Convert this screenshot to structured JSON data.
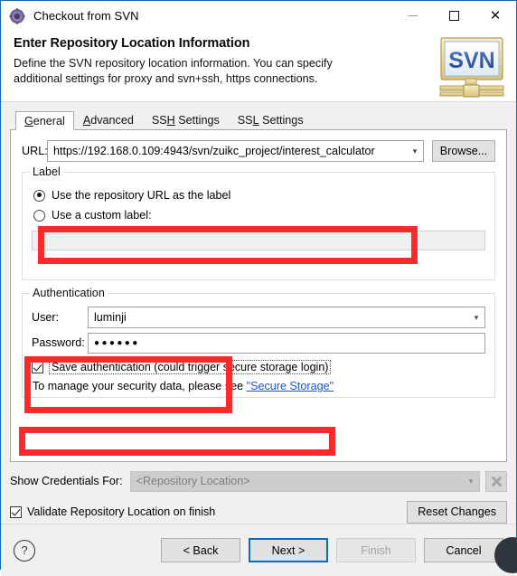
{
  "window": {
    "title": "Checkout from SVN",
    "icon": "svn-app-icon",
    "minimize_label": "—",
    "maximize_label": "□",
    "close_label": "✕"
  },
  "header": {
    "title": "Enter Repository Location Information",
    "description": "Define the SVN repository location information. You can specify additional settings for proxy and svn+ssh, https connections.",
    "logo_text": "SVN"
  },
  "tabs": [
    {
      "label": "General",
      "mnemonic": "G",
      "active": true
    },
    {
      "label": "Advanced",
      "mnemonic": "A",
      "active": false
    },
    {
      "label": "SSH Settings",
      "mnemonic": "H",
      "active": false
    },
    {
      "label": "SSL Settings",
      "mnemonic": "L",
      "active": false
    }
  ],
  "general": {
    "url_label": "URL:",
    "url_value": "https://192.168.0.109:4943/svn/zuikc_project/interest_calculator",
    "browse_label": "Browse...",
    "label_group": {
      "title": "Label",
      "option_repo_url": "Use the repository URL as the label",
      "option_repo_url_selected": true,
      "option_custom": "Use a custom label:",
      "option_custom_selected": false,
      "custom_value": "",
      "custom_enabled": false
    },
    "auth_group": {
      "title": "Authentication",
      "user_label": "User:",
      "user_value": "luminji",
      "password_label": "Password:",
      "password_value": "●●●●●●",
      "save_auth_label": "Save authentication (could trigger secure storage login)",
      "save_auth_checked": true,
      "secure_prefix": "To manage your security data, please see ",
      "secure_link": "\"Secure Storage\""
    }
  },
  "credentials": {
    "label": "Show Credentials For:",
    "selected": "<Repository Location>",
    "enabled": false,
    "clear_icon": "clear-credentials-icon"
  },
  "validate": {
    "label": "Validate Repository Location on finish",
    "checked": true,
    "reset_label": "Reset Changes"
  },
  "footer": {
    "help_label": "?",
    "back_label": "< Back",
    "next_label": "Next >",
    "finish_label": "Finish",
    "cancel_label": "Cancel",
    "next_is_default": true,
    "finish_disabled": true
  },
  "annotations": {
    "highlight_color": "#fb2b2b",
    "boxes": [
      "url-field",
      "authentication-user-password",
      "save-authentication-checkbox"
    ]
  },
  "colors": {
    "accent": "#0c6bbd",
    "link": "#1a56c4",
    "dialog_bg": "#f0f0f0",
    "panel_bg": "#ffffff",
    "button_bg": "#e1e1e1"
  }
}
